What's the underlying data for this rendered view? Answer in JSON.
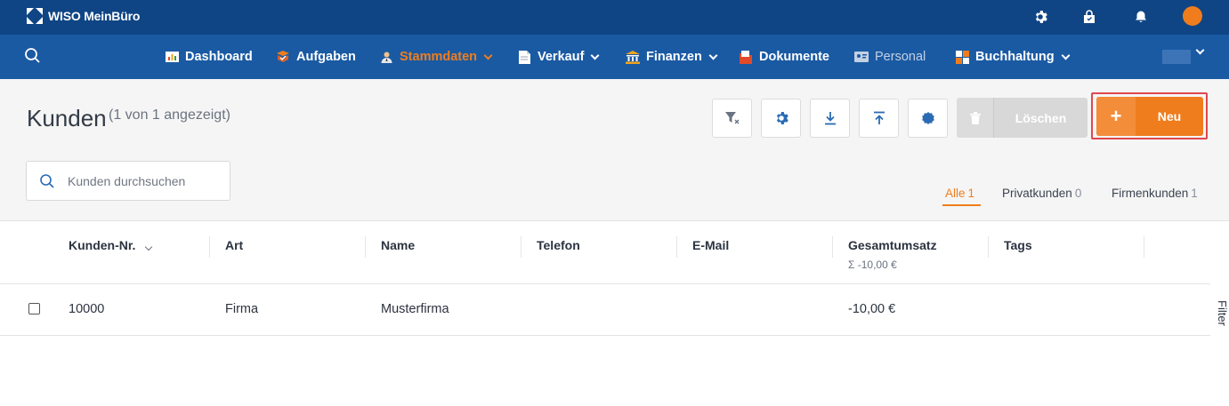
{
  "app": {
    "logo_text": "WISO MeinBüro"
  },
  "nav": {
    "items": [
      {
        "label": "Dashboard"
      },
      {
        "label": "Aufgaben"
      },
      {
        "label": "Stammdaten"
      },
      {
        "label": "Verkauf"
      },
      {
        "label": "Finanzen"
      },
      {
        "label": "Dokumente"
      },
      {
        "label": "Personal"
      },
      {
        "label": "Buchhaltung"
      }
    ]
  },
  "page": {
    "title": "Kunden",
    "subtitle": "(1 von 1 angezeigt)"
  },
  "toolbar": {
    "delete_label": "Löschen",
    "new_label": "Neu"
  },
  "search": {
    "placeholder": "Kunden durchsuchen"
  },
  "tabs": [
    {
      "label": "Alle",
      "count": "1"
    },
    {
      "label": "Privatkunden",
      "count": "0"
    },
    {
      "label": "Firmenkunden",
      "count": "1"
    }
  ],
  "table": {
    "columns": [
      "Kunden-Nr.",
      "Art",
      "Name",
      "Telefon",
      "E-Mail",
      "Gesamtumsatz",
      "Tags"
    ],
    "sum_label": "Σ -10,00 €",
    "rows": [
      {
        "nr": "10000",
        "art": "Firma",
        "name": "Musterfirma",
        "telefon": "",
        "email": "",
        "umsatz": "-10,00 €",
        "tags": ""
      }
    ]
  },
  "side_panel": {
    "label": "Filter"
  },
  "colors": {
    "topbar": "#0f4584",
    "navbar": "#1a5aa3",
    "accent": "#f07d1d",
    "highlight": "#e0474c"
  }
}
